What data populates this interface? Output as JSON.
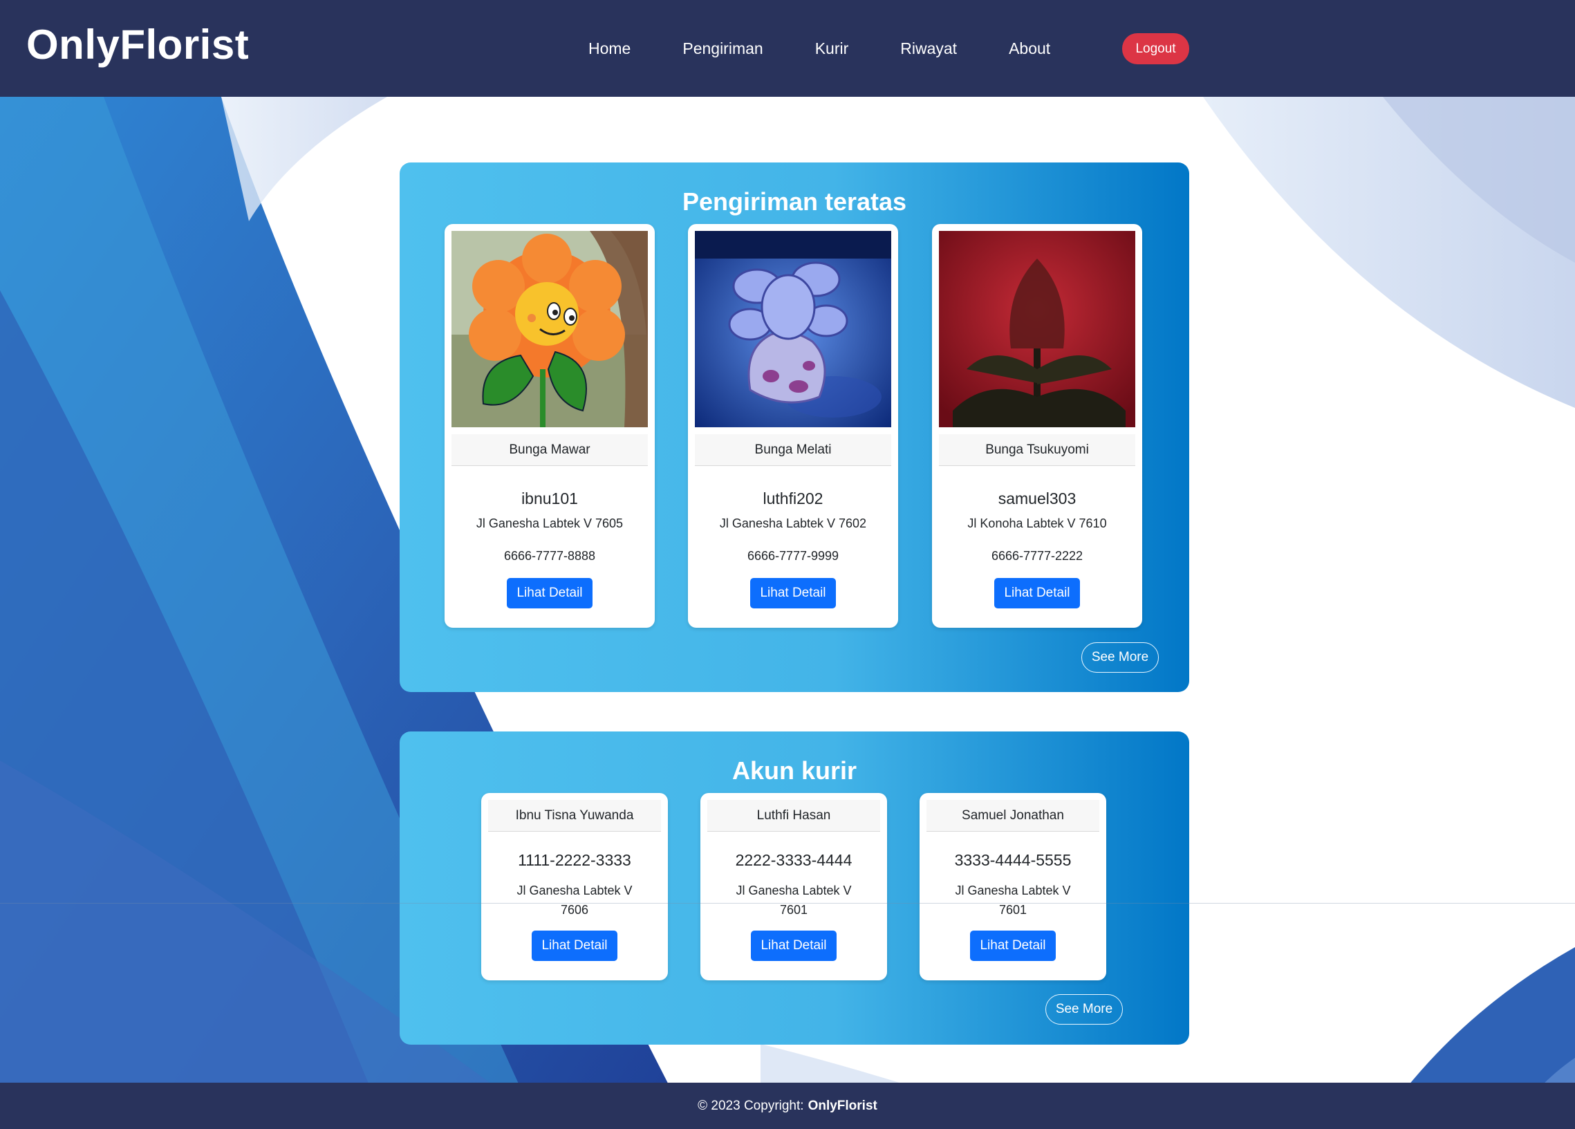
{
  "navbar": {
    "brand": "OnlyFlorist",
    "links": [
      "Home",
      "Pengiriman",
      "Kurir",
      "Riwayat",
      "About"
    ],
    "logout_label": "Logout"
  },
  "pengiriman": {
    "title": "Pengiriman teratas",
    "cards": [
      {
        "flower": "Bunga Mawar",
        "username": "ibnu101",
        "address": "Jl Ganesha Labtek V 7605",
        "phone": "6666-7777-8888",
        "button": "Lihat Detail"
      },
      {
        "flower": "Bunga Melati",
        "username": "luthfi202",
        "address": "Jl Ganesha Labtek V 7602",
        "phone": "6666-7777-9999",
        "button": "Lihat Detail"
      },
      {
        "flower": "Bunga Tsukuyomi",
        "username": "samuel303",
        "address": "Jl Konoha Labtek V 7610",
        "phone": "6666-7777-2222",
        "button": "Lihat Detail"
      }
    ],
    "see_more": "See More"
  },
  "kurir": {
    "title": "Akun kurir",
    "cards": [
      {
        "name": "Ibnu Tisna Yuwanda",
        "phone": "1111-2222-3333",
        "address": "Jl Ganesha Labtek V 7606",
        "button": "Lihat Detail"
      },
      {
        "name": "Luthfi Hasan",
        "phone": "2222-3333-4444",
        "address": "Jl Ganesha Labtek V 7601",
        "button": "Lihat Detail"
      },
      {
        "name": "Samuel Jonathan",
        "phone": "3333-4444-5555",
        "address": "Jl Ganesha Labtek V 7601",
        "button": "Lihat Detail"
      }
    ],
    "see_more": "See More"
  },
  "footer": {
    "copyright": "© 2023 Copyright:",
    "brand": "OnlyFlorist"
  },
  "colors": {
    "navbar": "#29335c",
    "logout": "#dc3545",
    "primary_button": "#0d6efd",
    "section_gradient_start": "#4fc0ee",
    "section_gradient_end": "#0277c7"
  }
}
